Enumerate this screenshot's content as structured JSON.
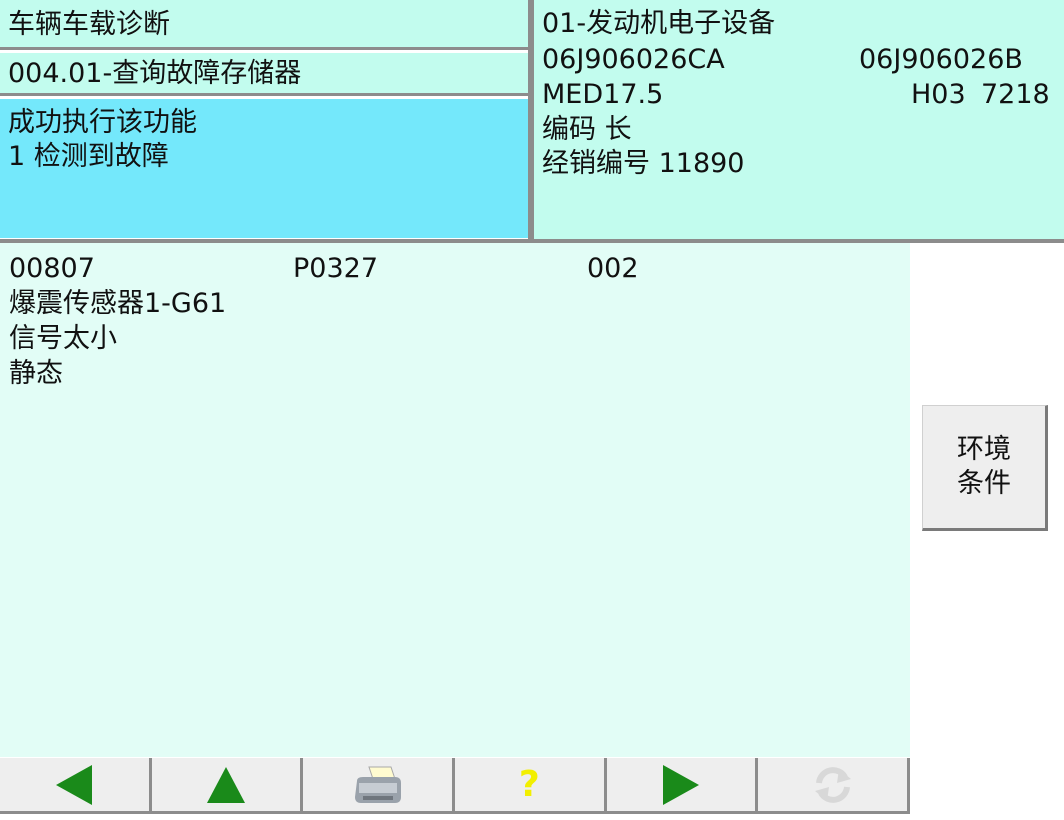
{
  "header": {
    "title": "车辆车载诊断",
    "function": "004.01-查询故障存储器",
    "status_line1": "成功执行该功能",
    "status_line2": "1 检测到故障"
  },
  "ecu": {
    "name": "01-发动机电子设备",
    "part_number": "06J906026CA",
    "part_number_alt": "06J906026B",
    "system": "MED17.5",
    "version": "H03",
    "version_code": "7218",
    "coding": "编码 长",
    "dealer": "经销编号 11890"
  },
  "fault": {
    "code": "00807",
    "pcode": "P0327",
    "count": "002",
    "component": "爆震传感器1-G61",
    "symptom": "信号太小",
    "state": "静态"
  },
  "side_button": {
    "line1": "环境",
    "line2": "条件"
  },
  "toolbar": {
    "help_glyph": "?",
    "icons": [
      "back-arrow-icon",
      "up-arrow-icon",
      "printer-icon",
      "help-icon",
      "forward-arrow-icon",
      "refresh-icon"
    ],
    "colors": {
      "arrow": "#1a8a1a",
      "help": "#f2ef00",
      "refresh_disabled": "#d8d8d8"
    }
  }
}
